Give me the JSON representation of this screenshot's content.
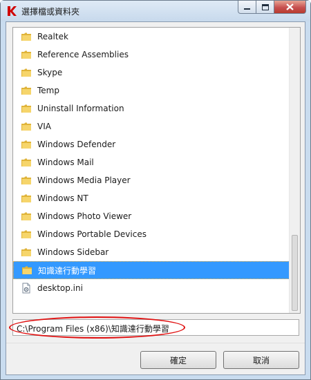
{
  "window": {
    "title": "選擇檔或資料夾",
    "app_icon": "kaspersky-k-icon"
  },
  "tree": {
    "items": [
      {
        "label": "Realtek",
        "icon": "folder-icon",
        "selected": false
      },
      {
        "label": "Reference Assemblies",
        "icon": "folder-icon",
        "selected": false
      },
      {
        "label": "Skype",
        "icon": "folder-icon",
        "selected": false
      },
      {
        "label": "Temp",
        "icon": "folder-icon",
        "selected": false
      },
      {
        "label": "Uninstall Information",
        "icon": "folder-icon",
        "selected": false
      },
      {
        "label": "VIA",
        "icon": "folder-icon",
        "selected": false
      },
      {
        "label": "Windows Defender",
        "icon": "folder-icon",
        "selected": false
      },
      {
        "label": "Windows Mail",
        "icon": "folder-icon",
        "selected": false
      },
      {
        "label": "Windows Media Player",
        "icon": "folder-icon",
        "selected": false
      },
      {
        "label": "Windows NT",
        "icon": "folder-icon",
        "selected": false
      },
      {
        "label": "Windows Photo Viewer",
        "icon": "folder-icon",
        "selected": false
      },
      {
        "label": "Windows Portable Devices",
        "icon": "folder-icon",
        "selected": false
      },
      {
        "label": "Windows Sidebar",
        "icon": "folder-icon",
        "selected": false
      },
      {
        "label": "知識達行動學習",
        "icon": "folder-icon",
        "selected": true
      },
      {
        "label": "desktop.ini",
        "icon": "ini-file-icon",
        "selected": false
      }
    ]
  },
  "path": {
    "value": "C:\\Program Files (x86)\\知識達行動學習"
  },
  "buttons": {
    "ok_label": "確定",
    "cancel_label": "取消"
  },
  "colors": {
    "selection": "#3399ff",
    "annotation": "#e01010",
    "folder": "#f3c84a"
  }
}
